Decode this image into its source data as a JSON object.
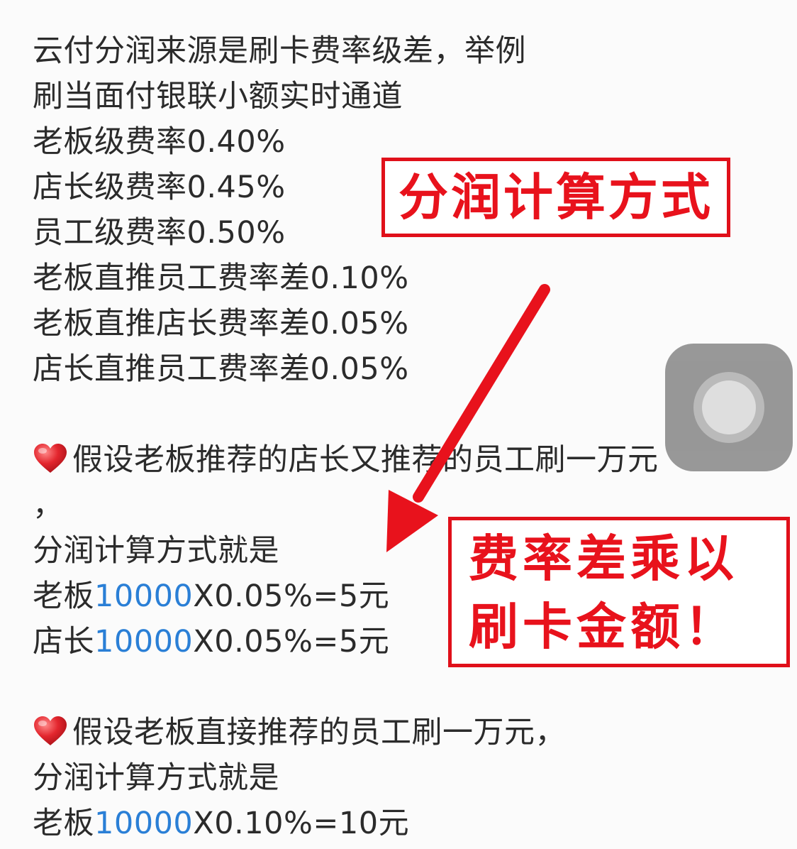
{
  "lines": {
    "l1": "云付分润来源是刷卡费率级差，举例",
    "l2": "刷当面付银联小额实时通道",
    "l3": "老板级费率0.40%",
    "l4": "店长级费率0.45%",
    "l5": "员工级费率0.50%",
    "l6": "老板直推员工费率差0.10%",
    "l7": "老板直推店长费率差0.05%",
    "l8": "店长直推员工费率差0.05%",
    "l9": "假设老板推荐的店长又推荐的员工刷一万元",
    "l10": "，",
    "l11": "分润计算方式就是",
    "l12_prefix": "老板",
    "l12_num": "10000",
    "l12_suffix": "X0.05%=5元",
    "l13_prefix": "店长",
    "l13_num": "10000",
    "l13_suffix": "X0.05%=5元",
    "l14": "假设老板直接推荐的员工刷一万元，",
    "l15": "分润计算方式就是",
    "l16_prefix": "老板",
    "l16_num": "10000",
    "l16_suffix": "X0.10%=10元"
  },
  "annotations": {
    "box1": "分润计算方式",
    "box2_line1": "费率差乘以",
    "box2_line2": "刷卡金额！"
  },
  "icons": {
    "heart": "red-heart-emoji",
    "float_button": "assistive-touch-icon",
    "arrow": "red-arrow"
  },
  "colors": {
    "text": "#2b2b2b",
    "link_number": "#2a7fd6",
    "annotation_red": "#e8121c"
  }
}
